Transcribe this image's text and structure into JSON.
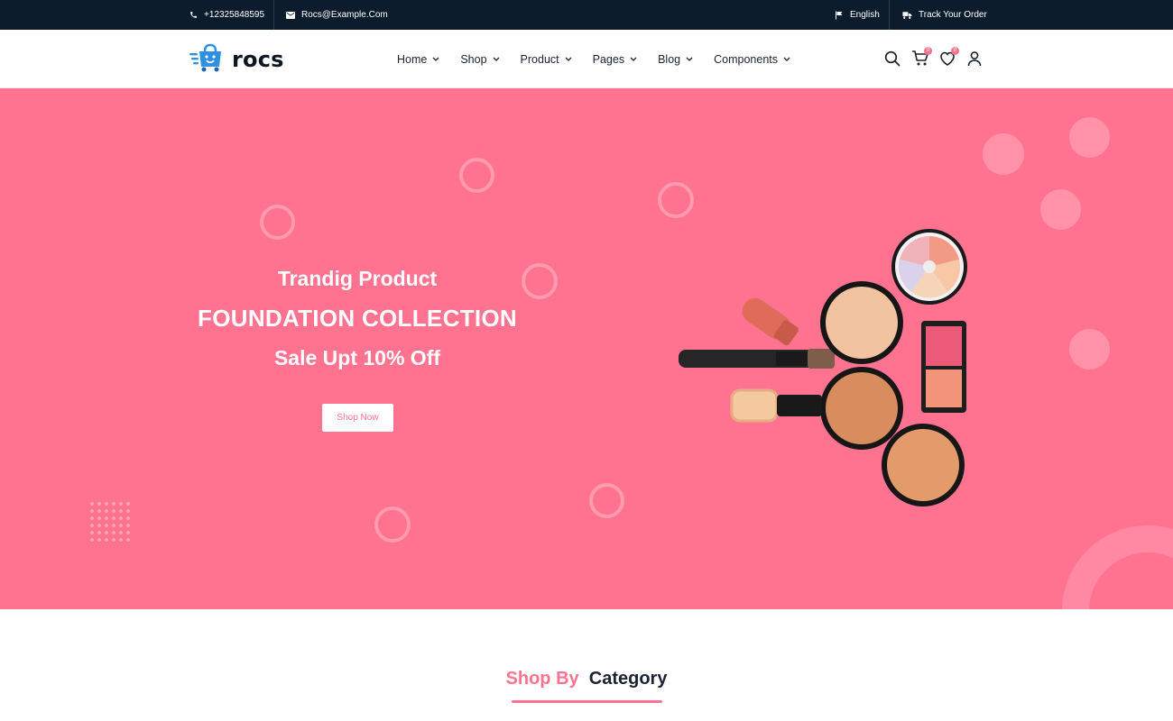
{
  "topbar": {
    "phone": "+12325848595",
    "email": "Rocs@Example.Com",
    "language": "English",
    "track_order": "Track Your Order"
  },
  "header": {
    "logo_text": "rocs",
    "nav": [
      {
        "label": "Home"
      },
      {
        "label": "Shop"
      },
      {
        "label": "Product"
      },
      {
        "label": "Pages"
      },
      {
        "label": "Blog"
      },
      {
        "label": "Components"
      }
    ],
    "cart_count": "0",
    "wishlist_count": "0"
  },
  "hero": {
    "subtitle": "Trandig Product",
    "title": "FOUNDATION COLLECTION",
    "offer": "Sale Upt 10% Off",
    "button_label": "Shop Now"
  },
  "category_section": {
    "title_part1": "Shop By",
    "title_part2": "Category"
  },
  "colors": {
    "accent": "#ff7391",
    "topbar_bg": "#0c1c2c",
    "text_dark": "#1b2232"
  },
  "icons": [
    "phone-icon",
    "mail-icon",
    "flag-icon",
    "truck-icon",
    "search-icon",
    "cart-icon",
    "heart-icon",
    "user-icon",
    "chevron-down-icon"
  ]
}
